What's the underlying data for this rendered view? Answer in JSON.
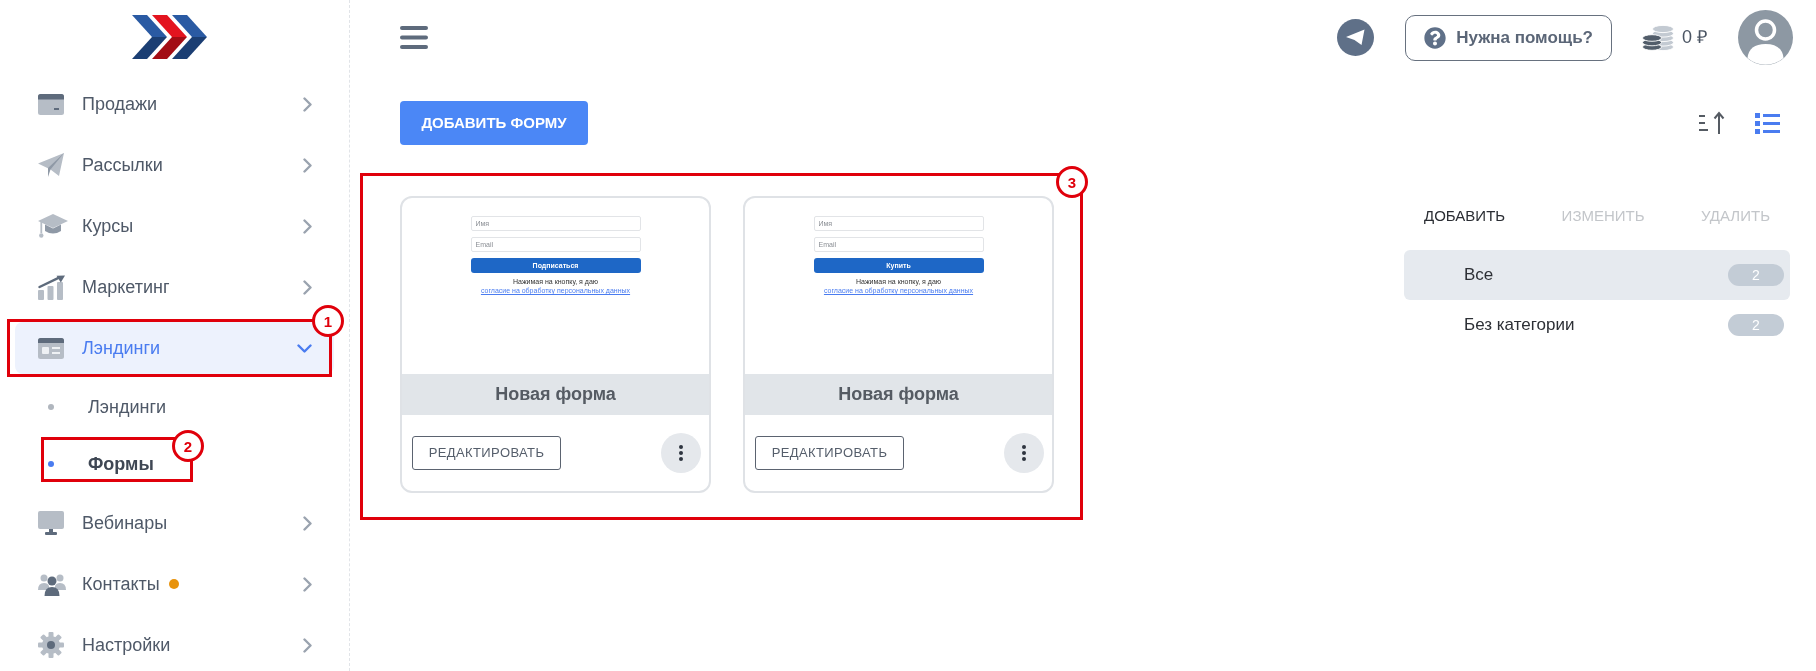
{
  "sidebar": {
    "items": [
      {
        "label": "Продажи",
        "selected": false,
        "expanded": false,
        "notification": false
      },
      {
        "label": "Рассылки",
        "selected": false,
        "expanded": false,
        "notification": false
      },
      {
        "label": "Курсы",
        "selected": false,
        "expanded": false,
        "notification": false
      },
      {
        "label": "Маркетинг",
        "selected": false,
        "expanded": false,
        "notification": false
      },
      {
        "label": "Лэндинги",
        "selected": true,
        "expanded": true,
        "notification": false,
        "annotation": "1",
        "children": [
          {
            "label": "Лэндинги",
            "selected": false
          },
          {
            "label": "Формы",
            "selected": true,
            "annotation": "2"
          }
        ]
      },
      {
        "label": "Вебинары",
        "selected": false,
        "expanded": false,
        "notification": false
      },
      {
        "label": "Контакты",
        "selected": false,
        "expanded": false,
        "notification": true
      },
      {
        "label": "Настройки",
        "selected": false,
        "expanded": false,
        "notification": false
      }
    ]
  },
  "header": {
    "help_button": "Нужна помощь?",
    "balance": "0 ₽"
  },
  "toolbar": {
    "add_button": "ДОБАВИТЬ ФОРМУ",
    "view_buttons": [
      {
        "kind": "sort",
        "selected": false
      },
      {
        "kind": "list",
        "selected": true
      }
    ]
  },
  "forms": {
    "annotation": "3",
    "cards": [
      {
        "title": "Новая форма",
        "edit_button": "РЕДАКТИРОВАТЬ",
        "preview": {
          "fields": [
            {
              "placeholder": "Имя"
            },
            {
              "placeholder": "Email"
            }
          ],
          "submit": "Подписаться",
          "consent": "Нажимая на кнопку, я даю",
          "consent_link": "согласие на обработку персональных данных"
        }
      },
      {
        "title": "Новая форма",
        "edit_button": "РЕДАКТИРОВАТЬ",
        "preview": {
          "fields": [
            {
              "placeholder": "Имя"
            },
            {
              "placeholder": "Email"
            }
          ],
          "submit": "Купить",
          "consent": "Нажимая на кнопку, я даю",
          "consent_link": "согласие на обработку персональных данных"
        }
      }
    ]
  },
  "categories": {
    "actions": [
      {
        "label": "ДОБАВИТЬ",
        "disabled": false
      },
      {
        "label": "ИЗМЕНИТЬ",
        "disabled": true
      },
      {
        "label": "УДАЛИТЬ",
        "disabled": true
      }
    ],
    "items": [
      {
        "label": "Все",
        "count": "2",
        "selected": true
      },
      {
        "label": "Без категории",
        "count": "2",
        "selected": false
      }
    ]
  }
}
